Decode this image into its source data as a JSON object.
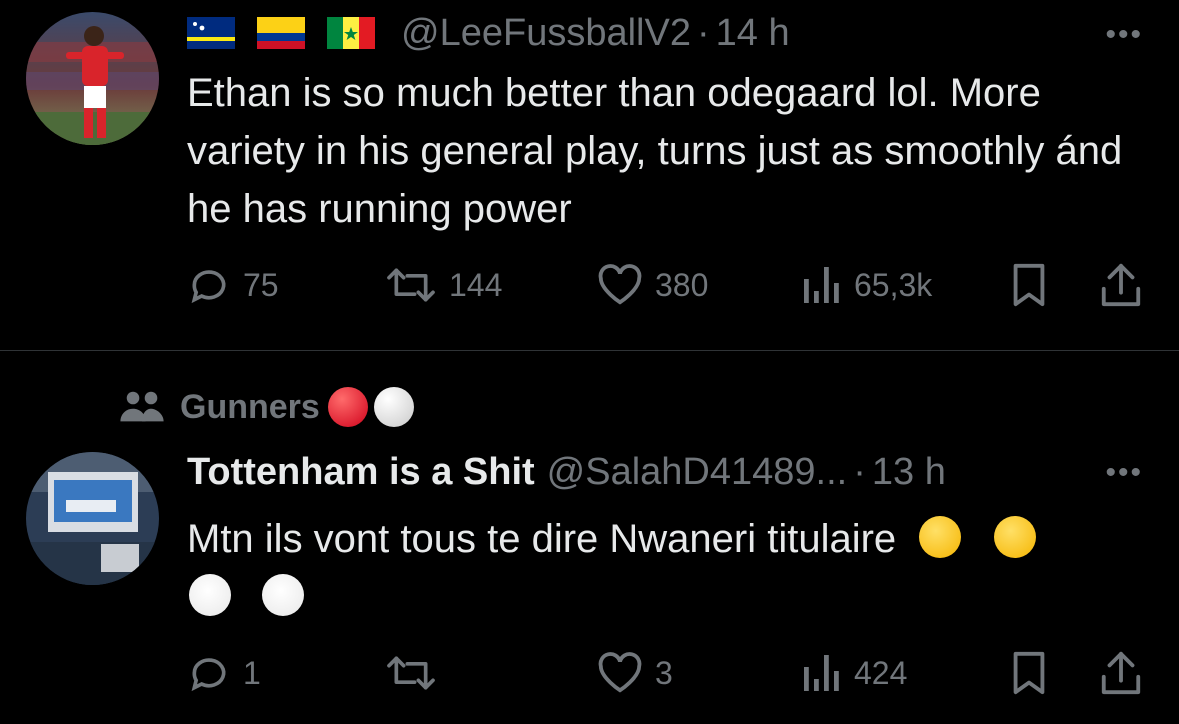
{
  "tweets": [
    {
      "flags": [
        "curacao-flag",
        "colombia-flag",
        "senegal-flag"
      ],
      "handle": "@LeeFussballV2",
      "separator": "·",
      "time": "14 h",
      "more": "•••",
      "text": "Ethan is so much better than odegaard lol. More variety in his general play, turns just as smoothly ánd he has running power",
      "actions": {
        "replies": "75",
        "reposts": "144",
        "likes": "380",
        "views": "65,3k"
      }
    },
    {
      "community": {
        "label": "Gunners",
        "icon": "community-icon"
      },
      "name": "Tottenham is a Shit",
      "handle": "@SalahD41489...",
      "separator": "·",
      "time": "13 h",
      "more": "•••",
      "text": "Mtn ils vont tous te dire Nwaneri titulaire",
      "emojis_line1": [
        "rolling-laughing-emoji",
        "rolling-laughing-emoji"
      ],
      "emojis_line2": [
        "clown-face-emoji",
        "clown-face-emoji"
      ],
      "actions": {
        "replies": "1",
        "reposts": "",
        "likes": "3",
        "views": "424"
      }
    }
  ],
  "colors": {
    "background": "#000000",
    "text": "#e7e9ea",
    "secondary": "#71767b",
    "divider": "#2f3336"
  }
}
